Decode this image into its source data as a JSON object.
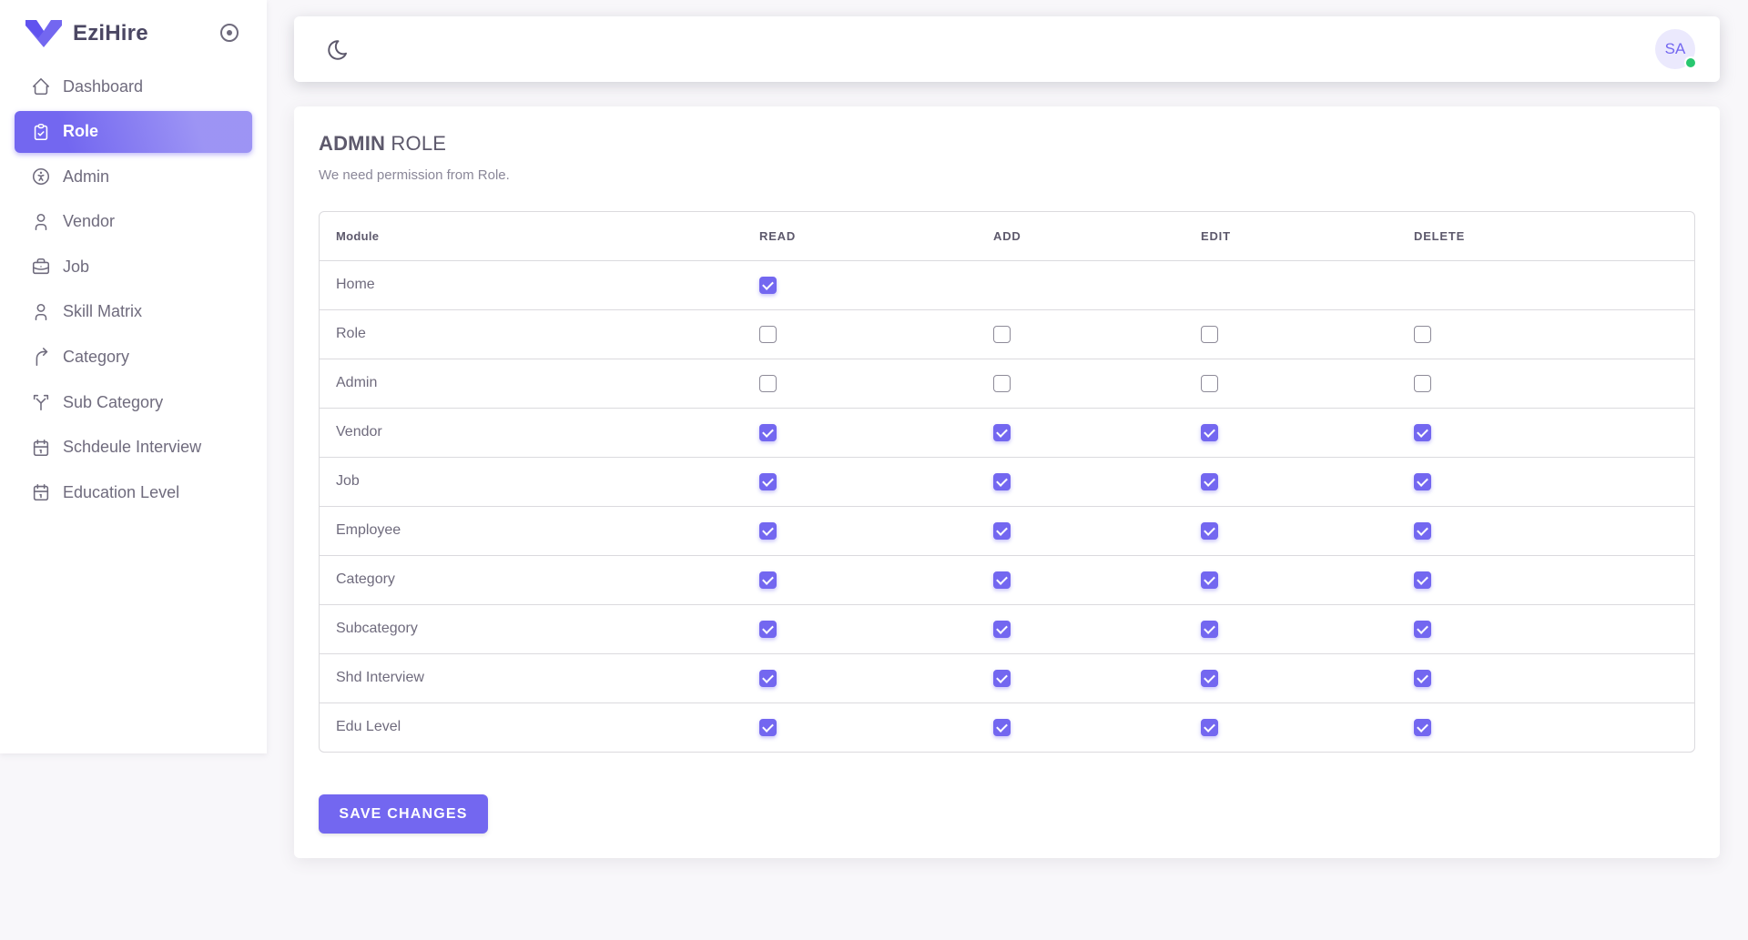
{
  "brand": {
    "name": "EziHire"
  },
  "sidebar": {
    "items": [
      {
        "label": "Dashboard",
        "icon": "home-icon"
      },
      {
        "label": "Role",
        "icon": "clipboard-check-icon",
        "active": true
      },
      {
        "label": "Admin",
        "icon": "accessible-icon"
      },
      {
        "label": "Vendor",
        "icon": "user-icon"
      },
      {
        "label": "Job",
        "icon": "briefcase-icon"
      },
      {
        "label": "Skill Matrix",
        "icon": "user-icon"
      },
      {
        "label": "Category",
        "icon": "corner-arrow-icon"
      },
      {
        "label": "Sub Category",
        "icon": "git-fork-icon"
      },
      {
        "label": "Schdeule Interview",
        "icon": "calendar-icon"
      },
      {
        "label": "Education Level",
        "icon": "calendar-icon"
      }
    ]
  },
  "topbar": {
    "avatar_initials": "SA"
  },
  "card": {
    "title_bold": "ADMIN",
    "title_rest": " ROLE",
    "subtitle": "We need permission from Role."
  },
  "table": {
    "headers": [
      "Module",
      "READ",
      "ADD",
      "EDIT",
      "DELETE"
    ],
    "rows": [
      {
        "module": "Home",
        "read": true,
        "add": null,
        "edit": null,
        "delete": null
      },
      {
        "module": "Role",
        "read": false,
        "add": false,
        "edit": false,
        "delete": false
      },
      {
        "module": "Admin",
        "read": false,
        "add": false,
        "edit": false,
        "delete": false
      },
      {
        "module": "Vendor",
        "read": true,
        "add": true,
        "edit": true,
        "delete": true
      },
      {
        "module": "Job",
        "read": true,
        "add": true,
        "edit": true,
        "delete": true
      },
      {
        "module": "Employee",
        "read": true,
        "add": true,
        "edit": true,
        "delete": true
      },
      {
        "module": "Category",
        "read": true,
        "add": true,
        "edit": true,
        "delete": true
      },
      {
        "module": "Subcategory",
        "read": true,
        "add": true,
        "edit": true,
        "delete": true
      },
      {
        "module": "Shd Interview",
        "read": true,
        "add": true,
        "edit": true,
        "delete": true
      },
      {
        "module": "Edu Level",
        "read": true,
        "add": true,
        "edit": true,
        "delete": true
      }
    ]
  },
  "save_button": {
    "label": "SAVE CHANGES"
  },
  "colors": {
    "accent": "#7367f0",
    "online": "#28c76f"
  }
}
